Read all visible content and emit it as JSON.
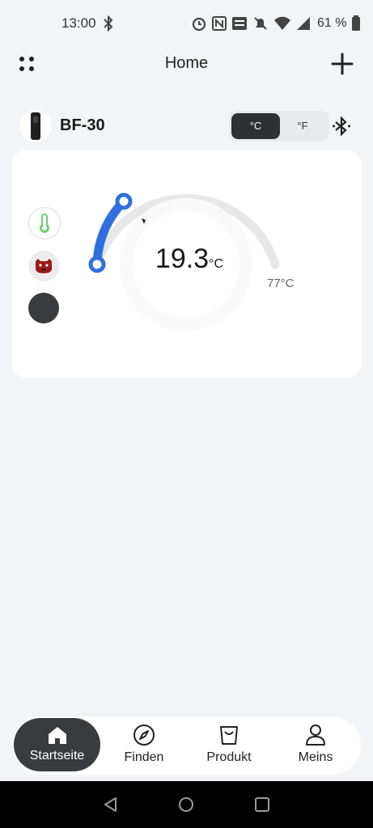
{
  "status_bar": {
    "time": "13:00",
    "battery": "61 %"
  },
  "header": {
    "title": "Home"
  },
  "device": {
    "name": "BF-30",
    "units": {
      "celsius": "°C",
      "fahrenheit": "°F",
      "selected": "celsius"
    }
  },
  "probe": {
    "current_temp": "19.3",
    "current_unit": "°C",
    "target_temp": "77°C",
    "icons": [
      "thermometer-icon",
      "meat-icon",
      "dark-probe-icon"
    ]
  },
  "nav": {
    "items": [
      {
        "label": "Startseite",
        "icon": "home-icon",
        "active": true
      },
      {
        "label": "Finden",
        "icon": "compass-icon"
      },
      {
        "label": "Produkt",
        "icon": "bag-icon"
      },
      {
        "label": "Meins",
        "icon": "person-icon"
      }
    ]
  },
  "colors": {
    "accent": "#2f6fe0",
    "active_nav": "#3a3b3f",
    "background": "#f3f4f8"
  }
}
